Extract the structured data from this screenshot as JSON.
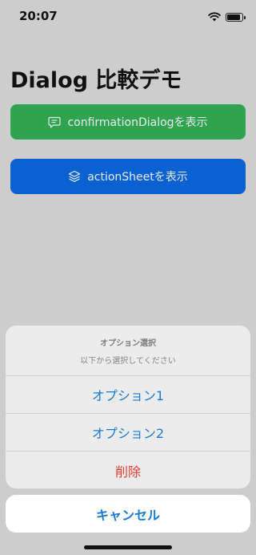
{
  "status_bar": {
    "time": "20:07",
    "battery_level": 0.9
  },
  "page": {
    "title": "Dialog 比較デモ"
  },
  "buttons": {
    "confirmation": {
      "label": "confirmationDialogを表示",
      "icon": "message-icon",
      "color": "#2fa34f"
    },
    "action_sheet": {
      "label": "actionSheetを表示",
      "icon": "layers-icon",
      "color": "#0a61d2"
    }
  },
  "sheet": {
    "title": "オプション選択",
    "message": "以下から選択してください",
    "options": [
      {
        "label": "オプション1",
        "role": "default"
      },
      {
        "label": "オプション2",
        "role": "default"
      },
      {
        "label": "削除",
        "role": "destructive"
      }
    ],
    "cancel_label": "キャンセル",
    "accent_color": "#1a7bd6",
    "destructive_color": "#e23a2c"
  }
}
